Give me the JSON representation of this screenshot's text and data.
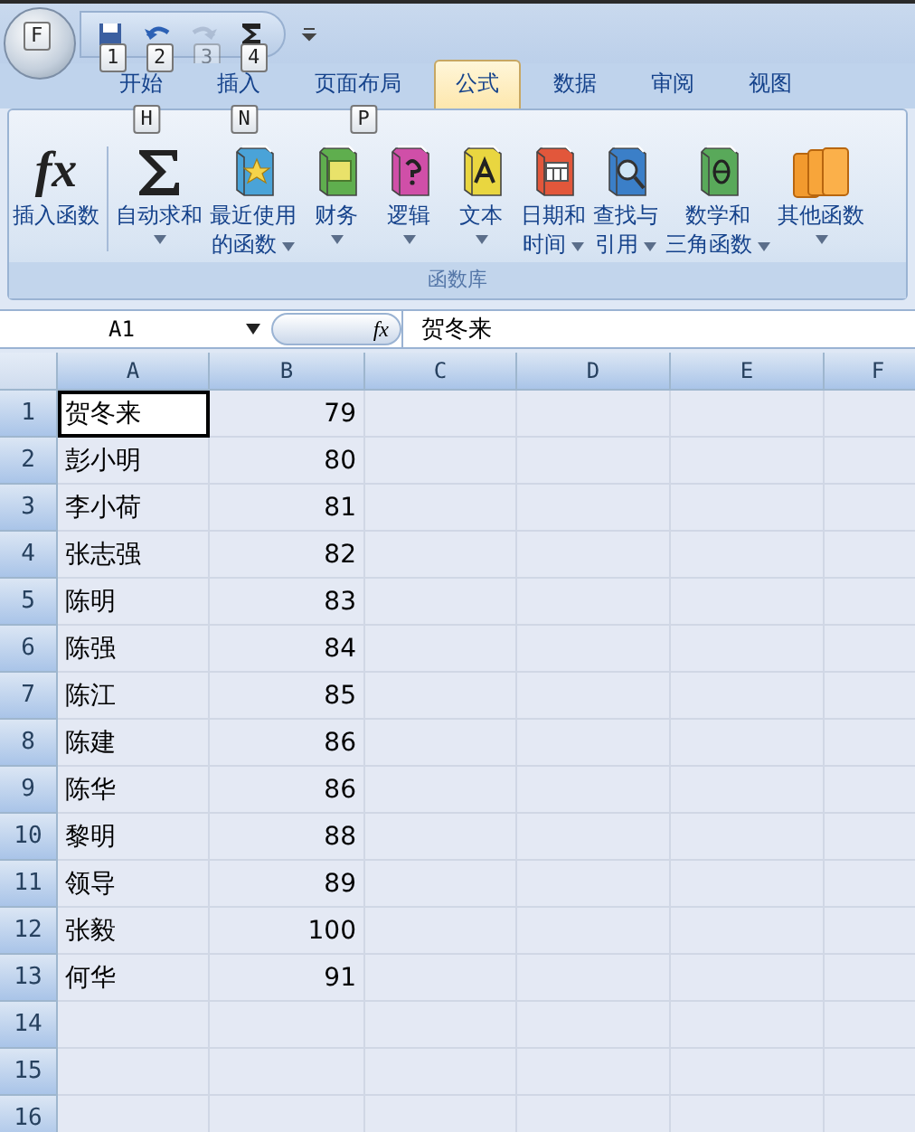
{
  "office_button": {
    "keytip": "F"
  },
  "quick_access": [
    {
      "kind": "save",
      "keytip": "1",
      "disabled": false
    },
    {
      "kind": "undo",
      "keytip": "2",
      "disabled": false
    },
    {
      "kind": "redo",
      "keytip": "3",
      "disabled": true
    },
    {
      "kind": "sum",
      "keytip": "4",
      "disabled": false
    }
  ],
  "tabs": [
    {
      "label": "开始",
      "selected": false,
      "keytip": "H"
    },
    {
      "label": "插入",
      "selected": false,
      "keytip": "N"
    },
    {
      "label": "页面布局",
      "selected": false,
      "keytip": "P"
    },
    {
      "label": "公式",
      "selected": true
    },
    {
      "label": "数据",
      "selected": false
    },
    {
      "label": "审阅",
      "selected": false
    },
    {
      "label": "视图",
      "selected": false
    }
  ],
  "ribbon": {
    "group_label": "函数库",
    "buttons": [
      {
        "kind": "fx",
        "symbol": "fx",
        "lines": [
          "插入函数"
        ],
        "dropdown": false
      },
      {
        "kind": "sigma",
        "lines": [
          "自动求和"
        ],
        "dropdown": true
      },
      {
        "kind": "book-star",
        "lines": [
          "最近使用",
          "的函数"
        ],
        "dropdown": true
      },
      {
        "kind": "book-money",
        "lines": [
          "财务"
        ],
        "dropdown": true
      },
      {
        "kind": "book-question",
        "lines": [
          "逻辑"
        ],
        "dropdown": true
      },
      {
        "kind": "book-letter",
        "lines": [
          "文本"
        ],
        "dropdown": true
      },
      {
        "kind": "book-calendar",
        "lines": [
          "日期和",
          "时间"
        ],
        "dropdown": true
      },
      {
        "kind": "book-search",
        "lines": [
          "查找与",
          "引用"
        ],
        "dropdown": true
      },
      {
        "kind": "book-theta",
        "lines": [
          "数学和",
          "三角函数"
        ],
        "dropdown": true
      },
      {
        "kind": "books",
        "lines": [
          "其他函数"
        ],
        "dropdown": true
      }
    ]
  },
  "name_box": "A1",
  "formula_button": "fx",
  "formula": "贺冬来",
  "sheet": {
    "all_selected": true,
    "columns": [
      "A",
      "B",
      "C",
      "D",
      "E",
      "F"
    ],
    "rows": [
      {
        "num": "1",
        "name": "贺冬来",
        "value": "79",
        "active": true
      },
      {
        "num": "2",
        "name": "彭小明",
        "value": "80",
        "active": false
      },
      {
        "num": "3",
        "name": "李小荷",
        "value": "81",
        "active": false
      },
      {
        "num": "4",
        "name": "张志强",
        "value": "82",
        "active": false
      },
      {
        "num": "5",
        "name": "陈明",
        "value": "83",
        "active": false
      },
      {
        "num": "6",
        "name": "陈强",
        "value": "84",
        "active": false
      },
      {
        "num": "7",
        "name": "陈江",
        "value": "85",
        "active": false
      },
      {
        "num": "8",
        "name": "陈建",
        "value": "86",
        "active": false
      },
      {
        "num": "9",
        "name": "陈华",
        "value": "86",
        "active": false
      },
      {
        "num": "10",
        "name": "黎明",
        "value": "88",
        "active": false
      },
      {
        "num": "11",
        "name": "领导",
        "value": "89",
        "active": false
      },
      {
        "num": "12",
        "name": "张毅",
        "value": "100",
        "active": false
      },
      {
        "num": "13",
        "name": "何华",
        "value": "91",
        "active": false
      },
      {
        "num": "14",
        "active": false
      },
      {
        "num": "15",
        "active": false
      },
      {
        "num": "16",
        "active": false
      }
    ]
  }
}
